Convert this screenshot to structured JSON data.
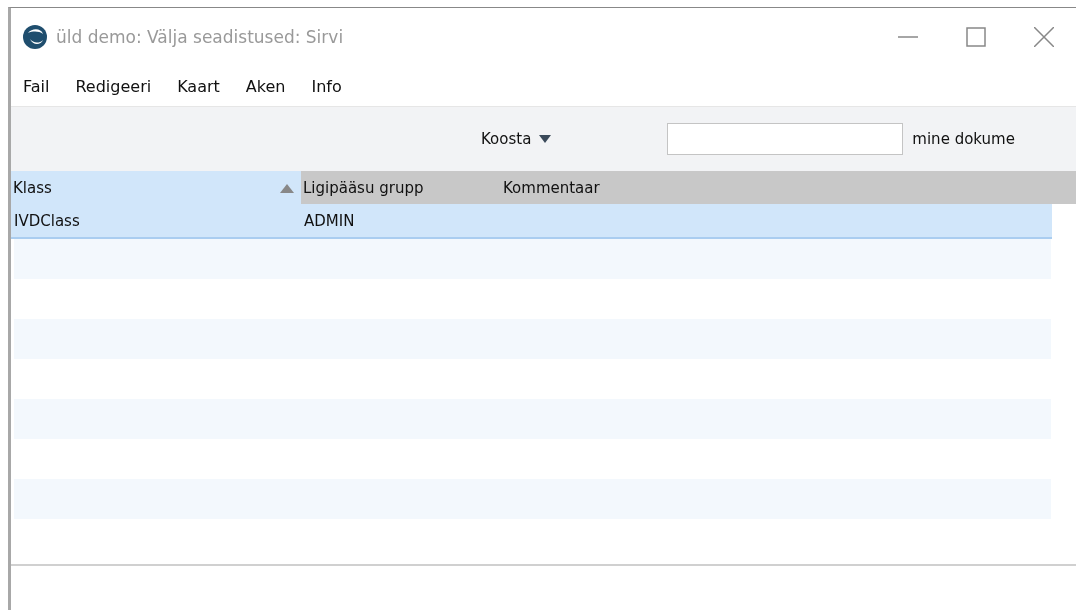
{
  "window": {
    "title": "üld demo: Välja seadistused: Sirvi"
  },
  "menu": [
    "Fail",
    "Redigeeri",
    "Kaart",
    "Aken",
    "Info"
  ],
  "toolbar": {
    "action_button": "Koosta",
    "search_label": "mine dokume"
  },
  "table": {
    "columns": [
      {
        "label": "Klass",
        "sorted": true
      },
      {
        "label": "Ligipääsu grupp",
        "sorted": false
      },
      {
        "label": "Kommentaar",
        "sorted": false
      }
    ],
    "rows": [
      {
        "cells": [
          "IVDClass",
          "ADMIN"
        ],
        "selected": true
      }
    ]
  }
}
